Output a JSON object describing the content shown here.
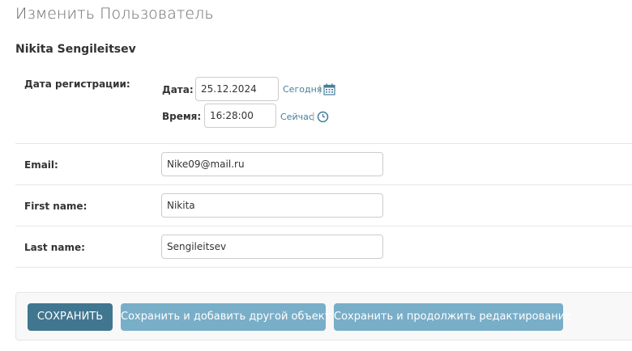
{
  "page": {
    "title": "Изменить Пользователь",
    "object_name": "Nikita Sengileitsev"
  },
  "date_joined": {
    "label": "Дата регистрации:",
    "date_label": "Дата:",
    "date_value": "25.12.2024",
    "today_link": "Сегодня",
    "time_label": "Время:",
    "time_value": "16:28:00",
    "now_link": "Сейчас",
    "separator": "|",
    "calendar_icon": "calendar-icon",
    "clock_icon": "clock-icon"
  },
  "fields": {
    "email": {
      "label": "Email:",
      "value": "Nike09@mail.ru"
    },
    "first_name": {
      "label": "First name:",
      "value": "Nikita"
    },
    "last_name": {
      "label": "Last name:",
      "value": "Sengileitsev"
    }
  },
  "buttons": {
    "save": "СОХРАНИТЬ",
    "save_add_another": "Сохранить и добавить другой объект",
    "save_continue": "Сохранить и продолжить редактирование"
  },
  "colors": {
    "link": "#447e9b",
    "primary_button": "#417690",
    "secondary_button": "#79aec8"
  }
}
